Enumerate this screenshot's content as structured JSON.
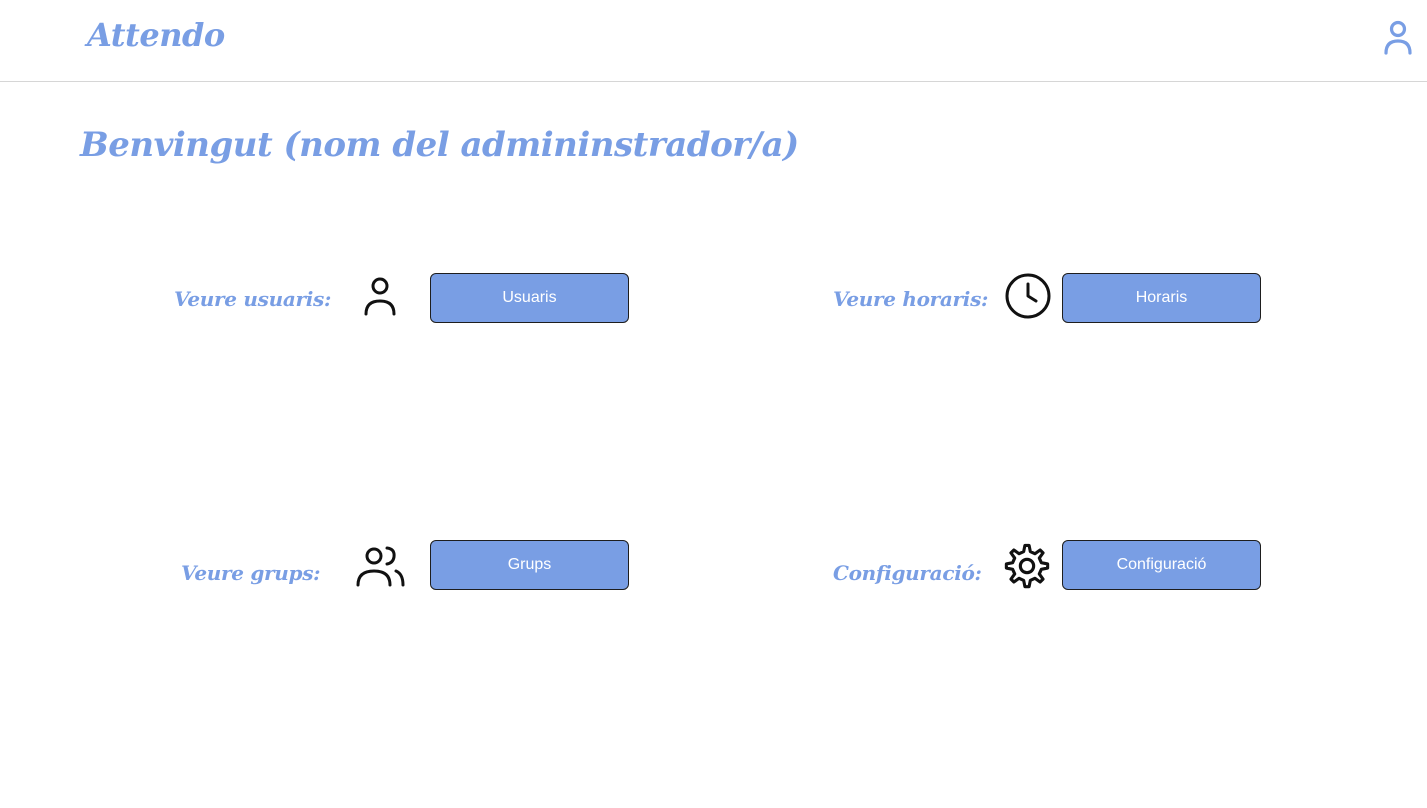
{
  "header": {
    "brand": "Attendo",
    "profile_icon": "user-icon"
  },
  "main": {
    "welcome": "Benvingut (nom del admininstrador/a)",
    "cards": [
      {
        "label": "Veure usuaris:",
        "icon": "user-icon",
        "button": "Usuaris"
      },
      {
        "label": "Veure horaris:",
        "icon": "clock-icon",
        "button": "Horaris"
      },
      {
        "label": "Veure grups:",
        "icon": "users-icon",
        "button": "Grups"
      },
      {
        "label": "Configuració:",
        "icon": "gear-icon",
        "button": "Configuració"
      }
    ]
  },
  "colors": {
    "accent": "#799ee4",
    "button_border": "#1e1e1e",
    "icon_stroke": "#111111"
  }
}
